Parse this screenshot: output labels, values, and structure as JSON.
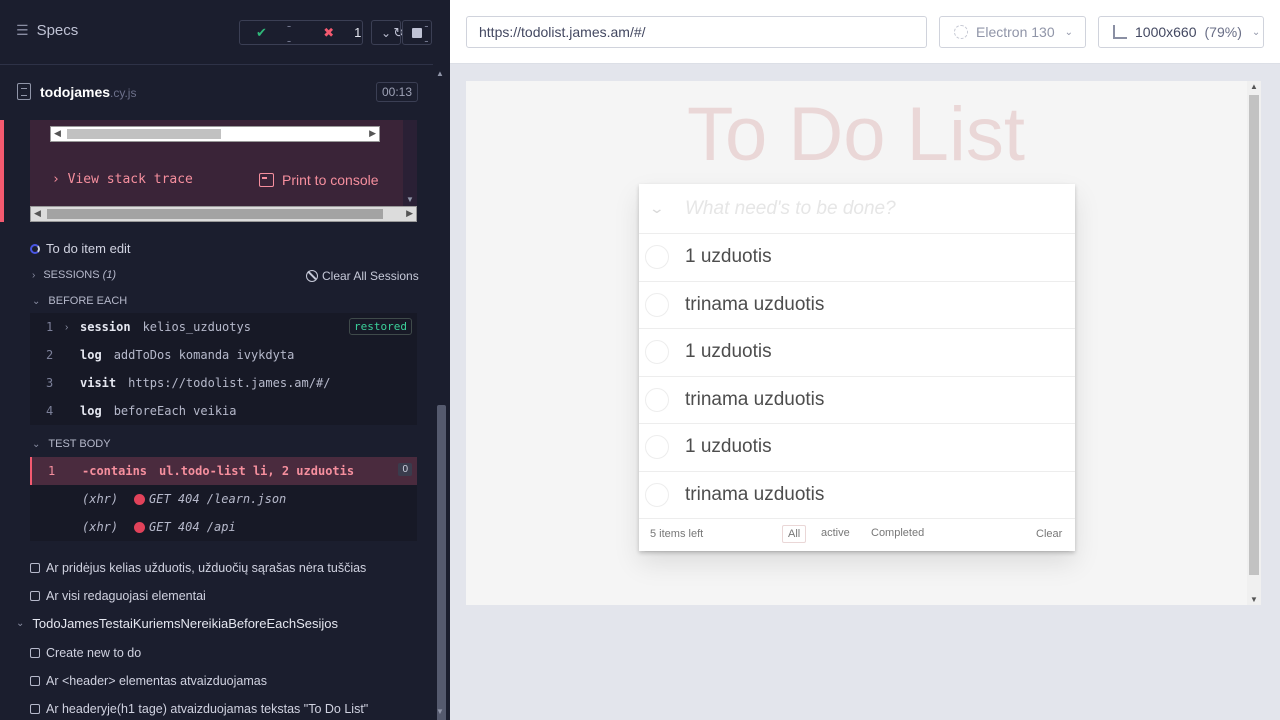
{
  "reporter": {
    "specs_label": "Specs",
    "stats": {
      "passed": "--",
      "failed": "1",
      "pending": "--"
    },
    "spec_name": "todojames",
    "spec_ext": ".cy.js",
    "duration": "00:13",
    "error": {
      "view_stack": "View stack trace",
      "print_console": "Print to console"
    },
    "current_test": "To do item edit",
    "sessions": {
      "label": "SESSIONS",
      "count": "(1)",
      "clear_label": "Clear All Sessions"
    },
    "before_each": {
      "label": "BEFORE EACH",
      "commands": [
        {
          "num": "1",
          "name": "session",
          "msg": "kelios_uzduotys",
          "badge": "restored"
        },
        {
          "num": "2",
          "name": "log",
          "msg": "addToDos komanda ivykdyta"
        },
        {
          "num": "3",
          "name": "visit",
          "msg": "https://todolist.james.am/#/"
        },
        {
          "num": "4",
          "name": "log",
          "msg": "beforeEach veikia"
        }
      ]
    },
    "test_body": {
      "label": "TEST BODY",
      "fail_cmd": {
        "num": "1",
        "name": "-contains",
        "msg": "ul.todo-list li, 2 uzduotis",
        "count": "0"
      },
      "xhr": [
        {
          "label": "(xhr)",
          "msg": "GET 404 /learn.json"
        },
        {
          "label": "(xhr)",
          "msg": "GET 404 /api"
        }
      ]
    },
    "other_tests": [
      "Ar pridėjus kelias užduotis, užduočių sąrašas nėra tuščias",
      "Ar visi redaguojasi elementai"
    ],
    "suite2": {
      "name": "TodoJamesTestaiKuriemsNereikiaBeforeEachSesijos",
      "tests": [
        "Create new to do",
        "Ar <header> elementas atvaizduojamas",
        "Ar headeryje(h1 tage) atvaizduojamas tekstas \"To Do List\""
      ]
    }
  },
  "aut": {
    "url": "https://todolist.james.am/#/",
    "browser": "Electron 130",
    "viewport": "1000x660",
    "zoom": "(79%)"
  },
  "app": {
    "title": "To Do List",
    "placeholder": "What need's to be done?",
    "todos": [
      "1 uzduotis",
      "trinama uzduotis",
      "1 uzduotis",
      "trinama uzduotis",
      "1 uzduotis",
      "trinama uzduotis"
    ],
    "items_left": "5 items left",
    "filters": [
      "All",
      "active",
      "Completed"
    ],
    "clear_label": "Clear"
  }
}
